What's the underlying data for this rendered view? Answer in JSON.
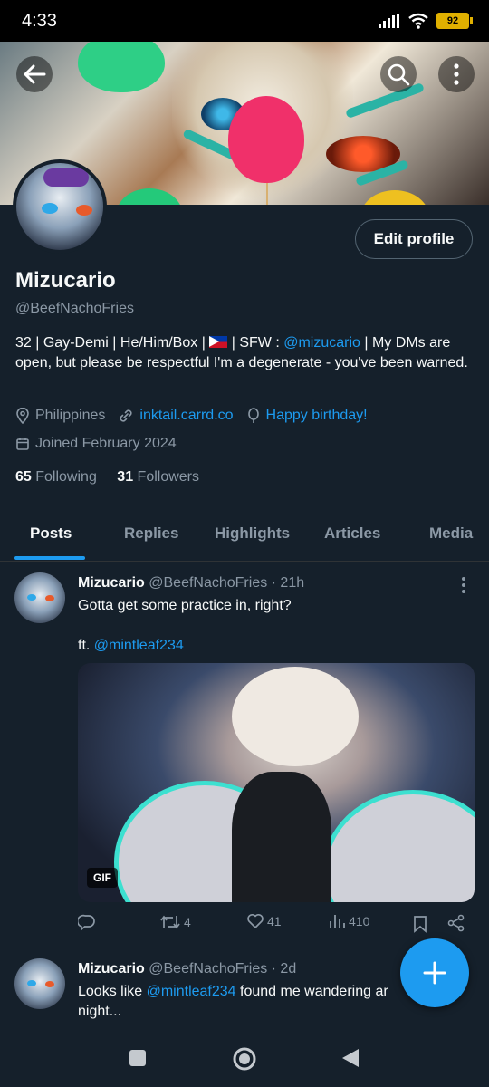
{
  "status_bar": {
    "time": "4:33",
    "battery": "92"
  },
  "profile": {
    "name": "Mizucario",
    "handle": "@BeefNachoFries",
    "edit_label": "Edit profile",
    "bio_pre": "32 | Gay-Demi | He/Him/Box | ",
    "bio_mid": " | SFW : ",
    "bio_link": "@mizucario",
    "bio_post": " | My DMs are open, but please be respectful I'm a degenerate - you've been warned.",
    "location": "Philippines",
    "website": "inktail.carrd.co",
    "birthday": "Happy birthday!",
    "joined": "Joined February 2024",
    "following_count": "65",
    "following_label": "Following",
    "followers_count": "31",
    "followers_label": "Followers"
  },
  "tabs": [
    "Posts",
    "Replies",
    "Highlights",
    "Articles",
    "Media"
  ],
  "posts": [
    {
      "name": "Mizucario",
      "meta": "@BeefNachoFries · 21h",
      "text_line1": "Gotta get some practice in, right?",
      "text_line2_pre": "ft. ",
      "text_line2_link": "@mintleaf234",
      "media_badge": "GIF",
      "retweets": "4",
      "likes": "41",
      "views": "410"
    },
    {
      "name": "Mizucario",
      "meta": "@BeefNachoFries · 2d",
      "text_pre": "Looks like ",
      "text_link": "@mintleaf234",
      "text_post": " found me wandering ar",
      "text_line2": "night..."
    }
  ],
  "icons": {
    "back": "arrow-left-icon",
    "search": "search-icon",
    "more": "more-vertical-icon",
    "compose": "plus-icon"
  },
  "colors": {
    "background": "#15202b",
    "accent": "#1d9bf0",
    "muted": "#8b98a5"
  }
}
